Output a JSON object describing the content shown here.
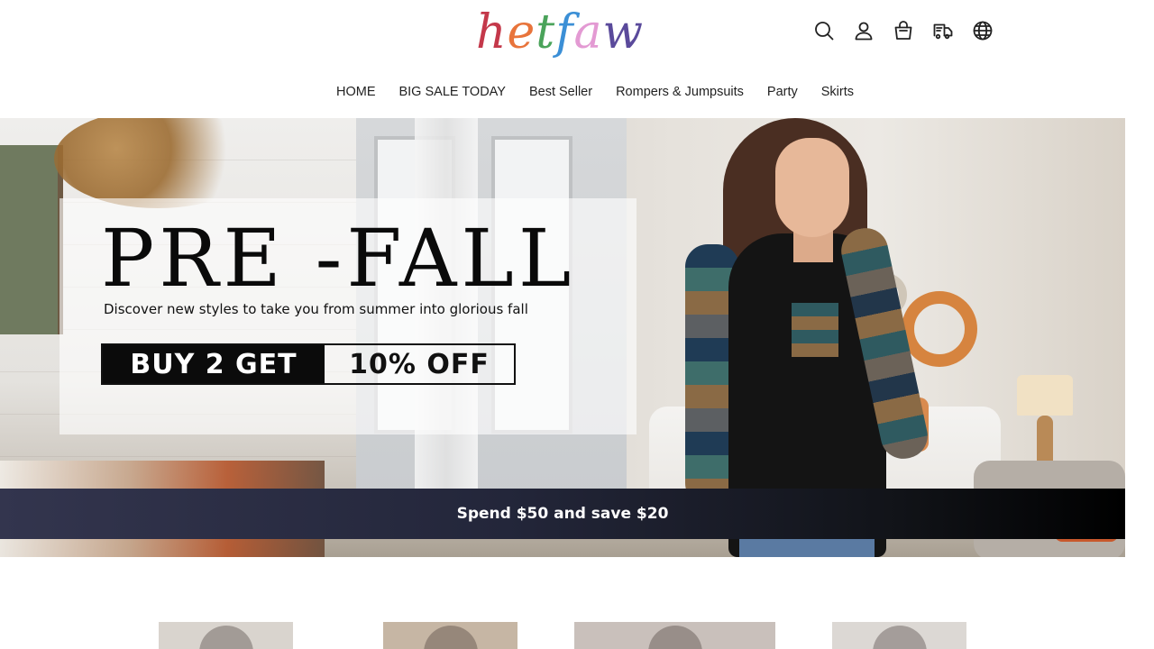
{
  "brand": {
    "logo_letters": [
      "h",
      "e",
      "t",
      "f",
      "a",
      "w"
    ],
    "logo_colors": [
      "#c4384a",
      "#e8743b",
      "#4aa35a",
      "#3b8fd6",
      "#e39ad3",
      "#5a4a9b"
    ]
  },
  "header_icons": [
    "search-icon",
    "account-icon",
    "cart-icon",
    "shipping-icon",
    "globe-icon"
  ],
  "nav": {
    "items": [
      "HOME",
      "BIG SALE TODAY",
      "Best Seller",
      "Rompers & Jumpsuits",
      "Party",
      "Skirts"
    ]
  },
  "hero": {
    "title": "PRE -FALL",
    "subtitle": "Discover new styles to take you from summer into glorious fall",
    "offer_left": "BUY 2 GET",
    "offer_right": "10% OFF"
  },
  "banner": {
    "text": "Spend $50 and save $20",
    "gradient_colors": [
      "#33354e",
      "#000000"
    ]
  },
  "products": {
    "colors": [
      "#d9d4ce",
      "#c6b6a4",
      "#c9c0bb",
      "#dcd8d4"
    ]
  }
}
